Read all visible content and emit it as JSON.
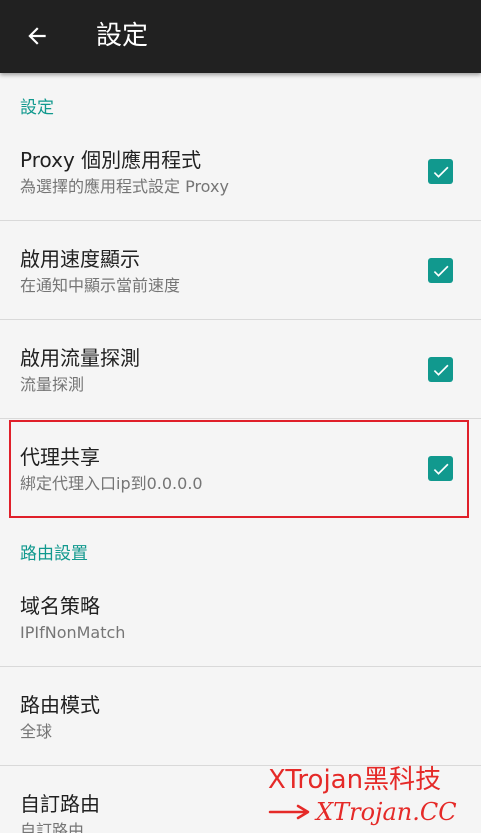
{
  "appbar": {
    "title": "設定",
    "back_icon": "arrow-left-icon"
  },
  "sections": [
    {
      "header": "設定",
      "items": [
        {
          "title": "Proxy 個別應用程式",
          "summary": "為選擇的應用程式設定 Proxy",
          "checked": true
        },
        {
          "title": "啟用速度顯示",
          "summary": "在通知中顯示當前速度",
          "checked": true
        },
        {
          "title": "啟用流量探測",
          "summary": "流量探測",
          "checked": true
        },
        {
          "title": "代理共享",
          "summary": "綁定代理入口ip到0.0.0.0",
          "checked": true
        }
      ]
    },
    {
      "header": "路由設置",
      "items": [
        {
          "title": "域名策略",
          "summary": "IPIfNonMatch"
        },
        {
          "title": "路由模式",
          "summary": "全球"
        },
        {
          "title": "自訂路由",
          "summary": "自訂路由"
        }
      ]
    }
  ],
  "watermark": {
    "line1": "XTrojan黑科技",
    "line2": "XTrojan.CC",
    "arrow_icon": "arrow-right-icon"
  },
  "colors": {
    "accent": "#11998e",
    "appbar": "#212121",
    "highlight": "#e0202a",
    "watermark": "#e52a28"
  }
}
